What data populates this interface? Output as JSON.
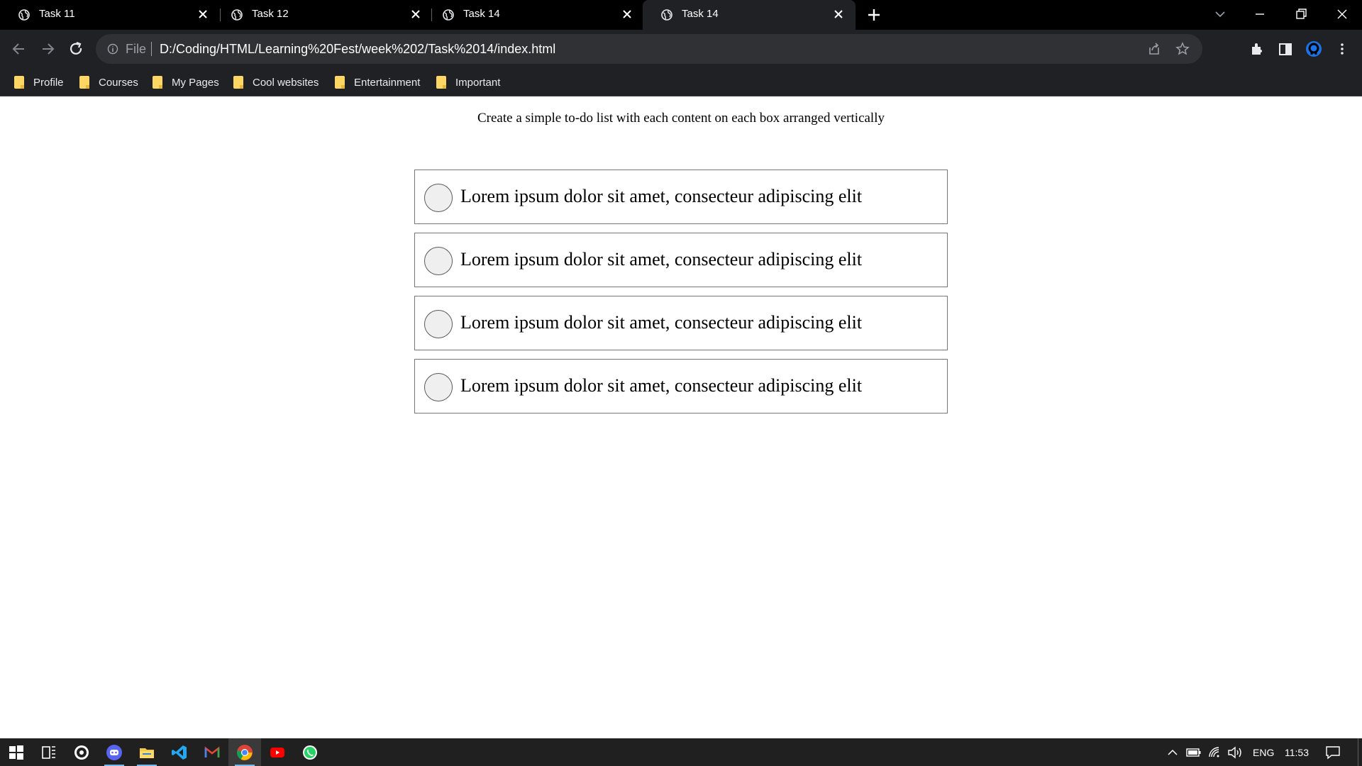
{
  "browser": {
    "tabs": [
      {
        "title": "Task 11",
        "active": false
      },
      {
        "title": "Task 12",
        "active": false
      },
      {
        "title": "Task 14",
        "active": false
      },
      {
        "title": "Task 14",
        "active": true
      }
    ],
    "omnibox": {
      "scheme_label": "File",
      "url": "D:/Coding/HTML/Learning%20Fest/week%202/Task%2014/index.html"
    },
    "bookmarks": [
      "Profile",
      "Courses",
      "My Pages",
      "Cool websites",
      "Entertainment",
      "Important"
    ]
  },
  "page": {
    "heading": "Create a simple to-do list with each content on each box arranged vertically",
    "items": [
      {
        "text": "Lorem ipsum dolor sit amet, consecteur adipiscing elit",
        "checked": false
      },
      {
        "text": "Lorem ipsum dolor sit amet, consecteur adipiscing elit",
        "checked": false
      },
      {
        "text": "Lorem ipsum dolor sit amet, consecteur adipiscing elit",
        "checked": false
      },
      {
        "text": "Lorem ipsum dolor sit amet, consecteur adipiscing elit",
        "checked": false
      }
    ]
  },
  "taskbar": {
    "apps": [
      "start-icon",
      "task-view-icon",
      "obs-icon",
      "discord-icon",
      "file-explorer-icon",
      "vscode-icon",
      "gmail-icon",
      "chrome-icon",
      "youtube-icon",
      "whatsapp-icon"
    ],
    "language": "ENG",
    "time": "11:53"
  },
  "colors": {
    "tab_strip": "#000000",
    "toolbar": "#202124",
    "folder": "#fdd663",
    "taskbar": "#202020"
  }
}
